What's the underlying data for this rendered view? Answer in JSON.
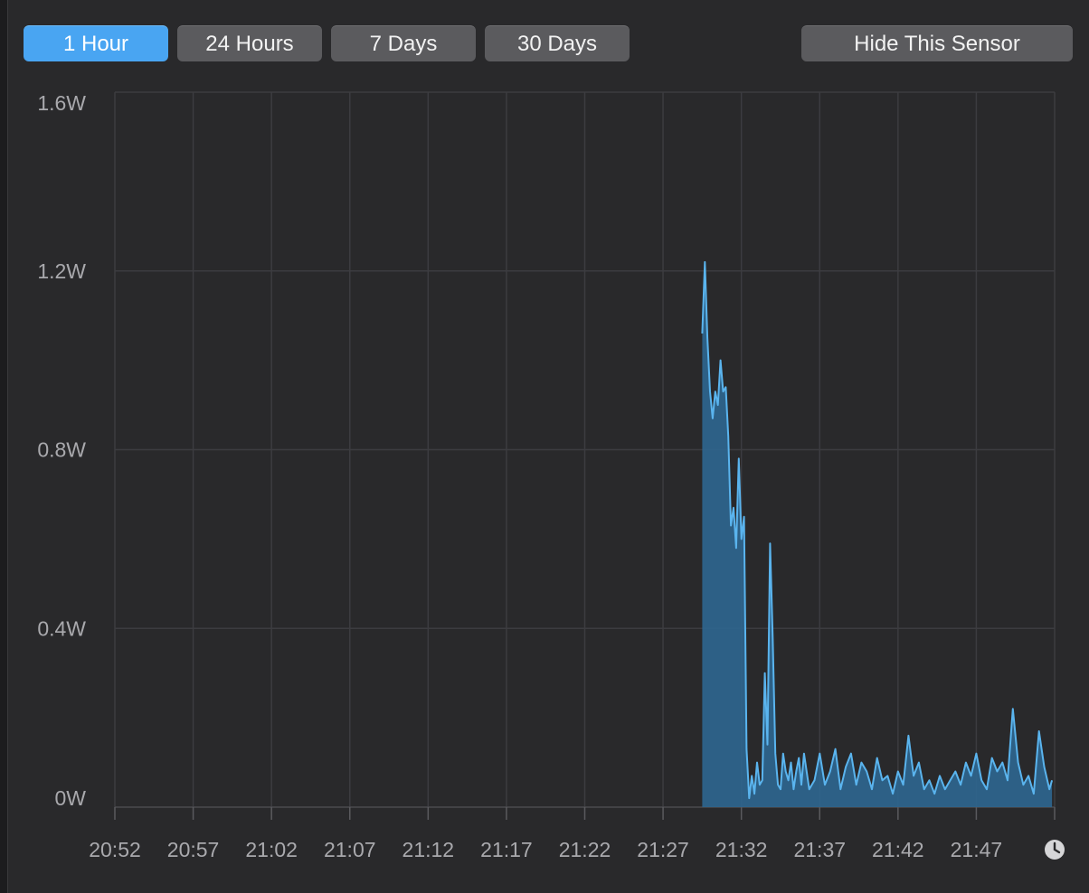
{
  "toolbar": {
    "range_buttons": [
      {
        "label": "1 Hour",
        "active": true
      },
      {
        "label": "24 Hours",
        "active": false
      },
      {
        "label": "7 Days",
        "active": false
      },
      {
        "label": "30 Days",
        "active": false
      }
    ],
    "hide_label": "Hide This Sensor"
  },
  "colors": {
    "accent": "#49a5f2",
    "line": "#5ab4ee",
    "fill": "#2e6690",
    "grid": "#3c3c40",
    "background": "#29292b"
  },
  "chart_data": {
    "type": "area",
    "ylim": [
      0,
      1.6
    ],
    "xlim": [
      "20:52",
      "21:52"
    ],
    "yticks": [
      "0W",
      "0.4W",
      "0.8W",
      "1.2W",
      "1.6W"
    ],
    "ytick_values": [
      0,
      0.4,
      0.8,
      1.2,
      1.6
    ],
    "xticks": [
      "20:52",
      "20:57",
      "21:02",
      "21:07",
      "21:12",
      "21:17",
      "21:22",
      "21:27",
      "21:32",
      "21:37",
      "21:42",
      "21:47"
    ],
    "clock_icon": "clock-icon",
    "grid": true,
    "series": [
      {
        "x": [
          "21:29:30",
          "21:29:40",
          "21:29:50",
          "21:30:00",
          "21:30:10",
          "21:30:20",
          "21:30:30",
          "21:30:40",
          "21:30:50",
          "21:31:00",
          "21:31:10",
          "21:31:20",
          "21:31:30",
          "21:31:40",
          "21:31:50",
          "21:32:00",
          "21:32:10",
          "21:32:20",
          "21:32:30",
          "21:32:40",
          "21:32:50",
          "21:33:00",
          "21:33:10",
          "21:33:20",
          "21:33:30",
          "21:33:40",
          "21:33:50",
          "21:34:00",
          "21:34:10",
          "21:34:20",
          "21:34:30",
          "21:34:40",
          "21:34:50",
          "21:35:00",
          "21:35:10",
          "21:35:20",
          "21:35:30",
          "21:35:40",
          "21:35:50",
          "21:36:00",
          "21:36:20",
          "21:36:40",
          "21:37:00",
          "21:37:20",
          "21:37:40",
          "21:38:00",
          "21:38:20",
          "21:38:40",
          "21:39:00",
          "21:39:20",
          "21:39:40",
          "21:40:00",
          "21:40:20",
          "21:40:40",
          "21:41:00",
          "21:41:20",
          "21:41:40",
          "21:42:00",
          "21:42:20",
          "21:42:40",
          "21:43:00",
          "21:43:20",
          "21:43:40",
          "21:44:00",
          "21:44:20",
          "21:44:40",
          "21:45:00",
          "21:45:20",
          "21:45:40",
          "21:46:00",
          "21:46:20",
          "21:46:40",
          "21:47:00",
          "21:47:20",
          "21:47:40",
          "21:48:00",
          "21:48:20",
          "21:48:40",
          "21:49:00",
          "21:49:20",
          "21:49:40",
          "21:50:00",
          "21:50:20",
          "21:50:40",
          "21:51:00",
          "21:51:20",
          "21:51:40",
          "21:51:50"
        ],
        "y": [
          1.06,
          1.22,
          1.05,
          0.93,
          0.87,
          0.93,
          0.9,
          1.0,
          0.93,
          0.94,
          0.83,
          0.63,
          0.67,
          0.58,
          0.78,
          0.6,
          0.65,
          0.13,
          0.02,
          0.07,
          0.03,
          0.1,
          0.05,
          0.06,
          0.3,
          0.14,
          0.59,
          0.38,
          0.12,
          0.05,
          0.04,
          0.12,
          0.08,
          0.06,
          0.1,
          0.04,
          0.08,
          0.11,
          0.05,
          0.12,
          0.04,
          0.06,
          0.12,
          0.05,
          0.08,
          0.13,
          0.04,
          0.09,
          0.12,
          0.05,
          0.1,
          0.08,
          0.04,
          0.11,
          0.06,
          0.07,
          0.03,
          0.08,
          0.05,
          0.16,
          0.07,
          0.1,
          0.04,
          0.06,
          0.03,
          0.07,
          0.04,
          0.06,
          0.08,
          0.05,
          0.1,
          0.07,
          0.12,
          0.06,
          0.04,
          0.11,
          0.08,
          0.1,
          0.06,
          0.22,
          0.1,
          0.05,
          0.07,
          0.03,
          0.17,
          0.09,
          0.04,
          0.06
        ]
      }
    ]
  }
}
